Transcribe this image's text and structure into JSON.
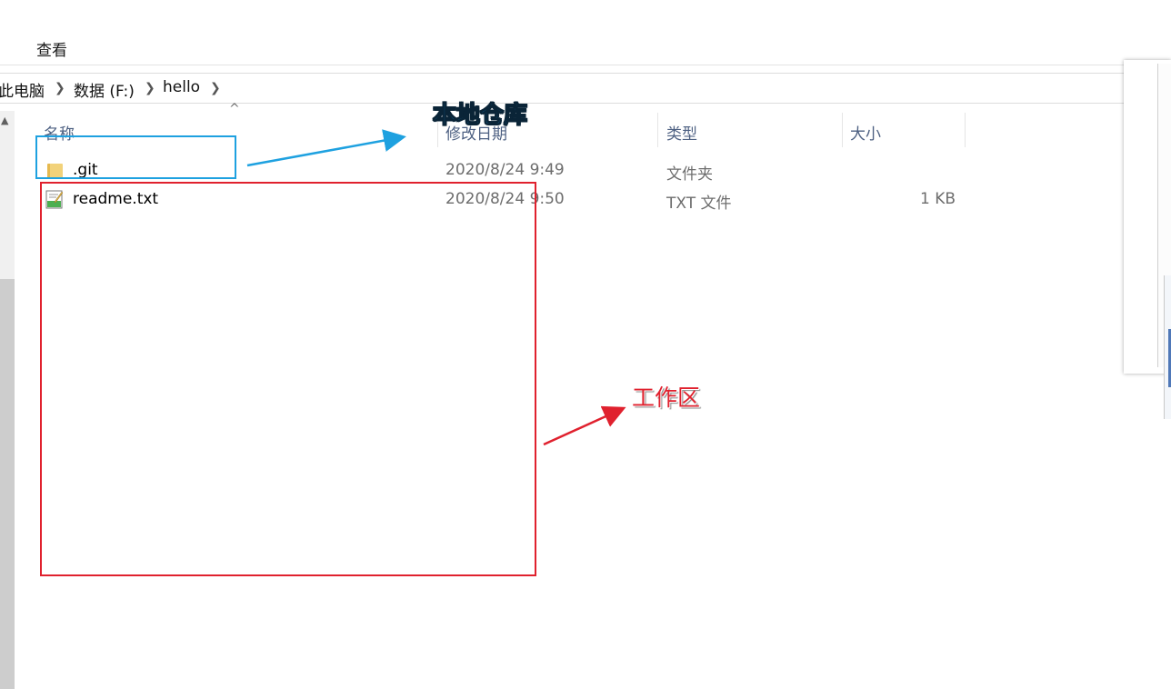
{
  "ribbon": {
    "tab_label": "查看"
  },
  "address_bar": {
    "crumbs": [
      "此电脑",
      "数据 (F:)",
      "hello"
    ]
  },
  "columns": {
    "name": "名称",
    "modified": "修改日期",
    "type": "类型",
    "size": "大小"
  },
  "files": [
    {
      "name": ".git",
      "modified": "2020/8/24 9:49",
      "type": "文件夹",
      "size": "",
      "icon": "folder-icon"
    },
    {
      "name": "readme.txt",
      "modified": "2020/8/24 9:50",
      "type": "TXT 文件",
      "size": "1 KB",
      "icon": "text-file-icon"
    }
  ],
  "annotations": {
    "local_repo": "本地仓库",
    "working_area": "工作区",
    "blue_color": "#1ea1e0",
    "red_color": "#e0212e"
  }
}
